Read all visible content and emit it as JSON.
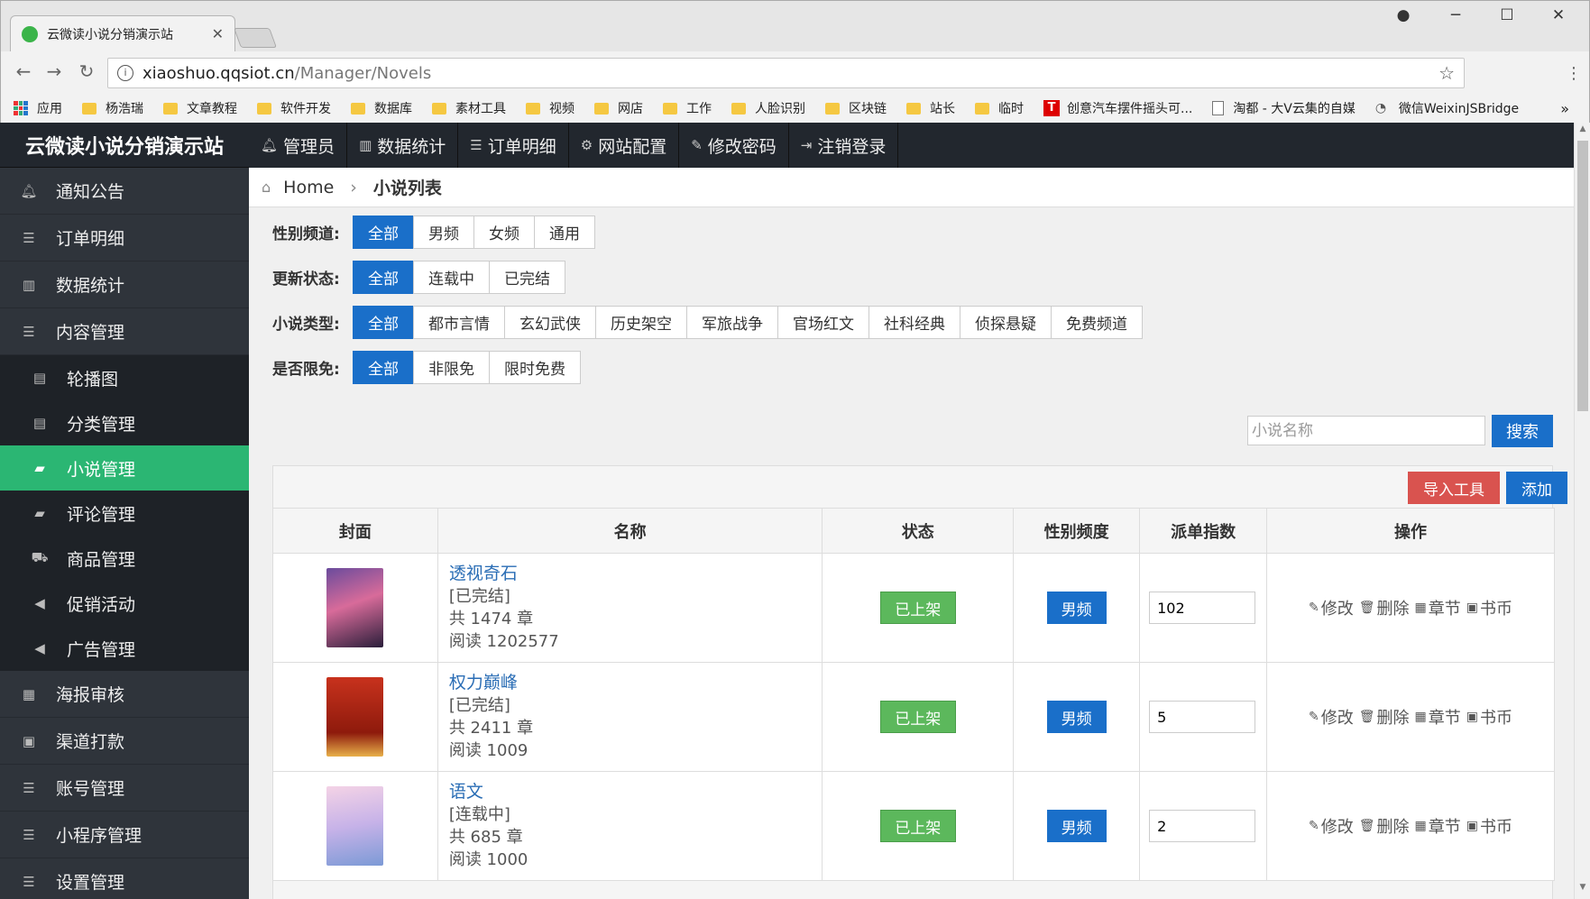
{
  "browser": {
    "tab_title": "云微读小说分销演示站",
    "url_host": "xiaoshuo.qqsiot.cn",
    "url_path": "/Manager/Novels",
    "bookmarks": [
      "应用",
      "杨浩瑞",
      "文章教程",
      "软件开发",
      "数据库",
      "素材工具",
      "视频",
      "网店",
      "工作",
      "人脸识别",
      "区块链",
      "站长",
      "临时",
      "创意汽车摆件摇头可...",
      "淘都 - 大V云集的自媒",
      "微信WeixinJSBridge"
    ]
  },
  "brand": "云微读小说分销演示站",
  "topnav": [
    {
      "icon": "bell-icon",
      "label": "管理员"
    },
    {
      "icon": "bar-chart-icon",
      "label": "数据统计"
    },
    {
      "icon": "list-icon",
      "label": "订单明细"
    },
    {
      "icon": "gear-icon",
      "label": "网站配置"
    },
    {
      "icon": "edit-icon",
      "label": "修改密码"
    },
    {
      "icon": "logout-icon",
      "label": "注销登录"
    }
  ],
  "sidebar": [
    {
      "label": "通知公告",
      "icon": "bell-icon"
    },
    {
      "label": "订单明细",
      "icon": "list-icon"
    },
    {
      "label": "数据统计",
      "icon": "bar-chart-icon"
    },
    {
      "label": "内容管理",
      "icon": "list-icon"
    },
    {
      "label": "轮播图",
      "icon": "list-alt-icon",
      "sub": true
    },
    {
      "label": "分类管理",
      "icon": "list-alt-icon",
      "sub": true
    },
    {
      "label": "小说管理",
      "icon": "book-icon",
      "sub": true,
      "active": true
    },
    {
      "label": "评论管理",
      "icon": "book-icon",
      "sub": true
    },
    {
      "label": "商品管理",
      "icon": "truck-icon",
      "sub": true
    },
    {
      "label": "促销活动",
      "icon": "bullhorn-icon",
      "sub": true
    },
    {
      "label": "广告管理",
      "icon": "bullhorn-icon",
      "sub": true
    },
    {
      "label": "海报审核",
      "icon": "table-icon"
    },
    {
      "label": "渠道打款",
      "icon": "money-icon"
    },
    {
      "label": "账号管理",
      "icon": "list-icon"
    },
    {
      "label": "小程序管理",
      "icon": "list-icon"
    },
    {
      "label": "设置管理",
      "icon": "list-icon"
    }
  ],
  "breadcrumb": {
    "home": "Home",
    "current": "小说列表"
  },
  "filters": [
    {
      "label": "性别频道:",
      "options": [
        "全部",
        "男频",
        "女频",
        "通用"
      ],
      "selected": 0
    },
    {
      "label": "更新状态:",
      "options": [
        "全部",
        "连载中",
        "已完结"
      ],
      "selected": 0
    },
    {
      "label": "小说类型:",
      "options": [
        "全部",
        "都市言情",
        "玄幻武侠",
        "历史架空",
        "军旅战争",
        "官场红文",
        "社科经典",
        "侦探悬疑",
        "免费频道"
      ],
      "selected": 0
    },
    {
      "label": "是否限免:",
      "options": [
        "全部",
        "非限免",
        "限时免费"
      ],
      "selected": 0
    }
  ],
  "search": {
    "placeholder": "小说名称",
    "button": "搜索"
  },
  "toolbar": {
    "import": "导入工具",
    "add": "添加"
  },
  "table": {
    "headers": [
      "封面",
      "名称",
      "状态",
      "性别频度",
      "派单指数",
      "操作"
    ],
    "rows": [
      {
        "title": "透视奇石",
        "status_text": "[已完结]",
        "chapters": "共 1474 章",
        "reads": "阅读 1202577",
        "state": "已上架",
        "gender": "男频",
        "index": "102"
      },
      {
        "title": "权力巅峰",
        "status_text": "[已完结]",
        "chapters": "共 2411 章",
        "reads": "阅读 1009",
        "state": "已上架",
        "gender": "男频",
        "index": "5"
      },
      {
        "title": "语文",
        "status_text": "[连载中]",
        "chapters": "共 685 章",
        "reads": "阅读 1000",
        "state": "已上架",
        "gender": "男频",
        "index": "2"
      }
    ],
    "actions": [
      "修改",
      "删除",
      "章节",
      "书币"
    ]
  }
}
